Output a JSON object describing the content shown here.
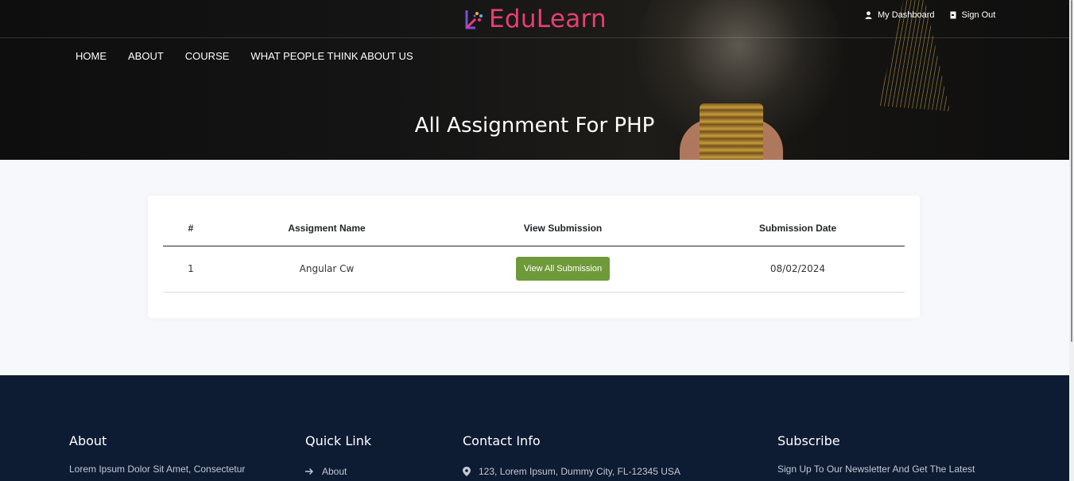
{
  "header": {
    "logo_text": "EduLearn",
    "brand_color": "#e63f73",
    "top_links": [
      {
        "label": "My Dashboard",
        "icon": "user-icon"
      },
      {
        "label": "Sign Out",
        "icon": "signout-icon"
      }
    ],
    "nav": [
      "HOME",
      "ABOUT",
      "COURSE",
      "WHAT PEOPLE THINK ABOUT US"
    ],
    "page_title": "All Assignment For PHP"
  },
  "table": {
    "headers": [
      "#",
      "Assigment Name",
      "View Submission",
      "Submission Date"
    ],
    "rows": [
      {
        "num": "1",
        "name": "Angular Cw",
        "button": "View All Submission",
        "date": "08/02/2024"
      }
    ],
    "button_color": "#6e9a3a"
  },
  "footer": {
    "about": {
      "title": "About",
      "text": "Lorem Ipsum Dolor Sit Amet, Consectetur"
    },
    "quick_link": {
      "title": "Quick Link",
      "items": [
        "About"
      ]
    },
    "contact": {
      "title": "Contact Info",
      "address": "123, Lorem Ipsum, Dummy City, FL-12345 USA"
    },
    "subscribe": {
      "title": "Subscribe",
      "text": "Sign Up To Our Newsletter And Get The Latest"
    },
    "background": "#0d1b33"
  }
}
